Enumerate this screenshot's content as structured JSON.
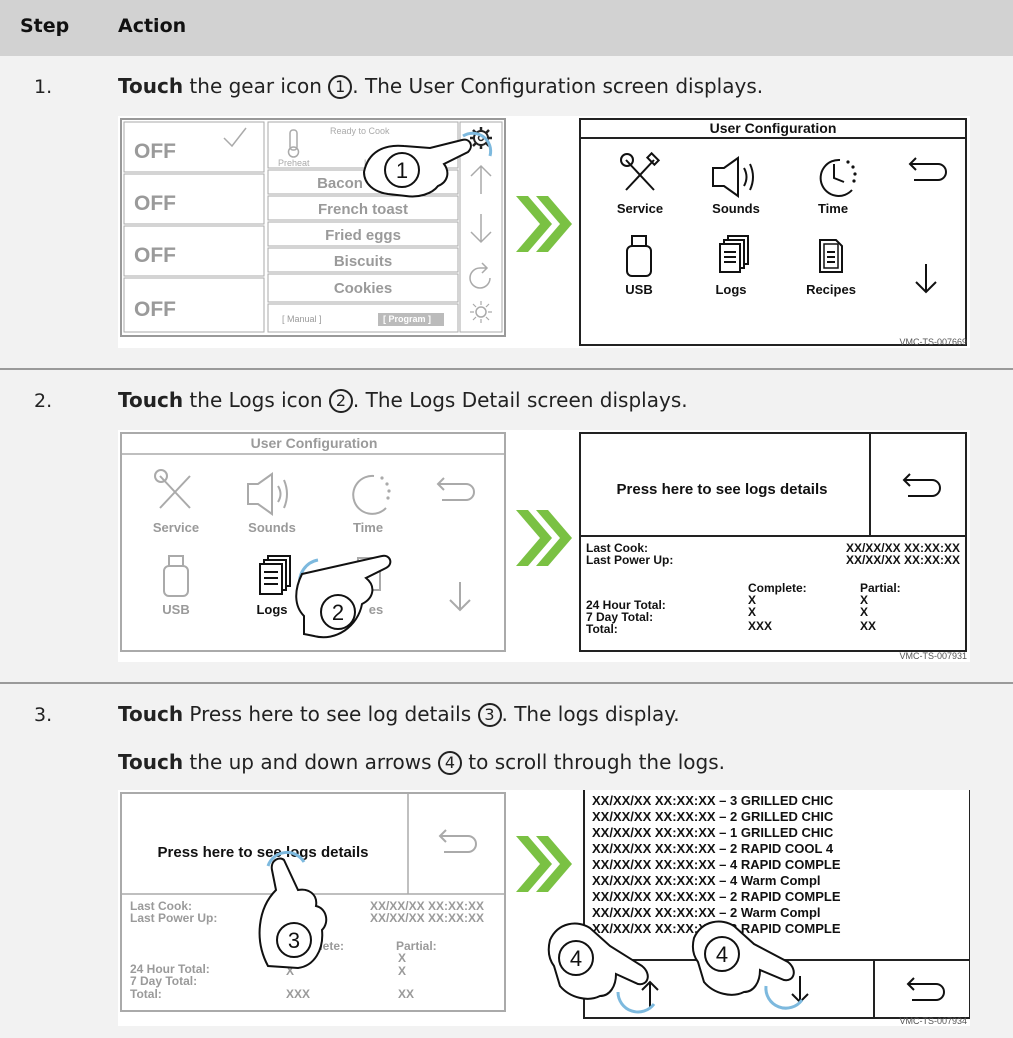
{
  "header": {
    "step": "Step",
    "action": "Action"
  },
  "steps": [
    {
      "number": "1.",
      "verb": "Touch",
      "text_before": " the gear icon ",
      "callout": "1",
      "text_after": ". The User Configuration screen displays.",
      "figure": {
        "code": "VMC-TS-007669",
        "left_screen": {
          "zones": [
            "OFF",
            "OFF",
            "OFF",
            "OFF"
          ],
          "status_text": "Ready to Cook",
          "preheat_label": "Preheat",
          "lights_label": "Li",
          "menu": [
            "Bacon",
            "French toast",
            "Fried eggs",
            "Biscuits",
            "Cookies"
          ],
          "manual_label": "[ Manual ]",
          "program_label": "[ Program ]"
        },
        "right_screen": {
          "title": "User Configuration",
          "icons": [
            "Service",
            "Sounds",
            "Time",
            "USB",
            "Logs",
            "Recipes"
          ]
        }
      }
    },
    {
      "number": "2.",
      "verb": "Touch",
      "text_before": " the Logs icon ",
      "callout": "2",
      "text_after": ". The Logs Detail screen displays.",
      "figure": {
        "code": "VMC-TS-007931",
        "left_screen": {
          "title": "User Configuration",
          "icons": [
            "Service",
            "Sounds",
            "Time",
            "USB",
            "Logs",
            "es"
          ]
        },
        "right_screen": {
          "press_text": "Press here to see logs details",
          "last_cook_label": "Last Cook:",
          "last_cook_value": "XX/XX/XX  XX:XX:XX",
          "last_power_label": "Last Power Up:",
          "last_power_value": "XX/XX/XX  XX:XX:XX",
          "complete_label": "Complete:",
          "partial_label": "Partial:",
          "totals": [
            {
              "label": "24 Hour Total:",
              "complete": "X",
              "partial": "X"
            },
            {
              "label": "7 Day Total:",
              "complete": "X",
              "partial": "X"
            },
            {
              "label": "Total:",
              "complete": "XXX",
              "partial": "XX"
            }
          ]
        }
      }
    },
    {
      "number": "3.",
      "verb": "Touch",
      "text_before": " Press here to see log details ",
      "callout": "3",
      "text_after": ". The logs display.",
      "verb2": "Touch",
      "text2_before": " the up and down arrows ",
      "callout2": "4",
      "text2_after": " to scroll through the logs.",
      "figure": {
        "code": "VMC-TS-007934",
        "left_screen": {
          "press_text": "Press here to see logs details",
          "last_cook_label": "Last Cook:",
          "last_cook_value": "XX/XX/XX  XX:XX:XX",
          "last_power_label": "Last Power Up:",
          "last_power_value": "XX/XX/XX  XX:XX:XX",
          "complete_label": "plete:",
          "partial_label": "Partial:",
          "totals": [
            {
              "label": "24 Hour Total:",
              "complete": "X",
              "partial": "X"
            },
            {
              "label": "7 Day Total:",
              "complete": "X",
              "partial": "X"
            },
            {
              "label": "Total:",
              "complete": "XXX",
              "partial": "XX"
            }
          ]
        },
        "right_screen": {
          "log_lines": [
            "XX/XX/XX XX:XX:XX – 3 GRILLED CHIC",
            "XX/XX/XX XX:XX:XX – 2 GRILLED CHIC",
            "XX/XX/XX XX:XX:XX – 1 GRILLED CHIC",
            "XX/XX/XX XX:XX:XX – 2 RAPID COOL 4",
            "XX/XX/XX XX:XX:XX – 4 RAPID COMPLE",
            "XX/XX/XX XX:XX:XX – 4 Warm Compl",
            "XX/XX/XX XX:XX:XX – 2 RAPID COMPLE",
            "XX/XX/XX XX:XX:XX – 2 Warm Compl",
            "XX/XX/XX XX:XX:XX – 3 RAPID COMPLE"
          ]
        }
      }
    }
  ]
}
